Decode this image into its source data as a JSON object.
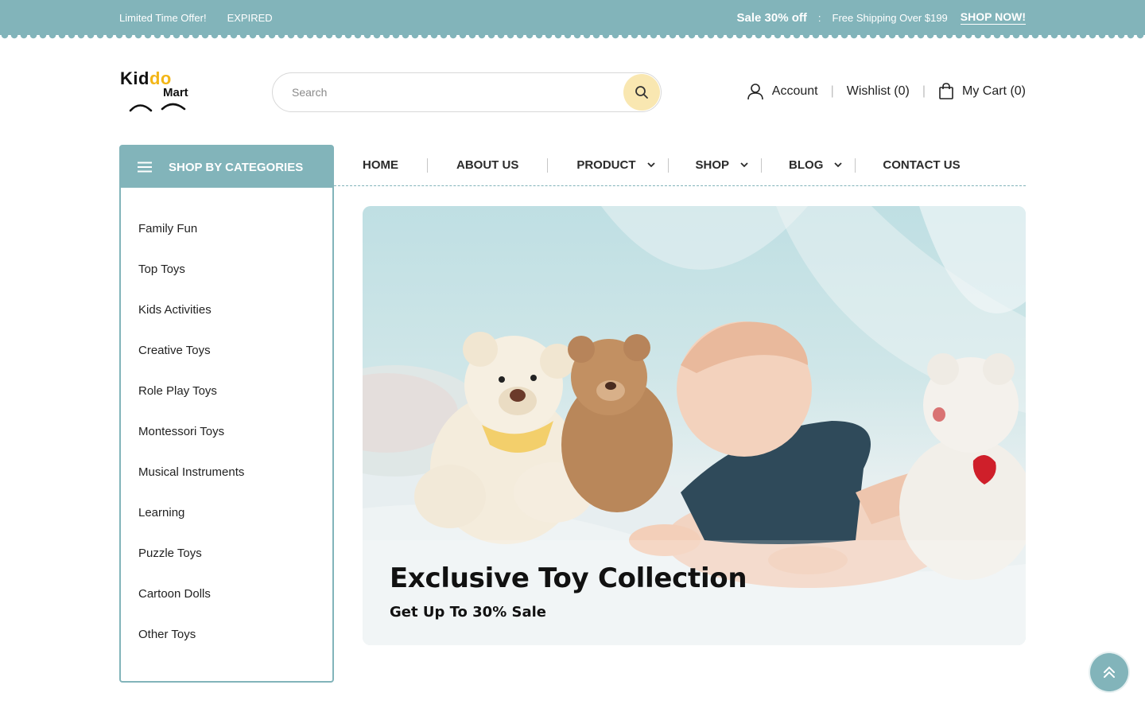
{
  "topbar": {
    "offer_label": "Limited Time Offer!",
    "offer_status": "EXPIRED",
    "sale": "Sale 30% off",
    "separator": ":",
    "shipping": "Free Shipping Over $199",
    "cta": "SHOP NOW!"
  },
  "logo": {
    "part1": "Kid",
    "part2": "do",
    "part3": "Mart"
  },
  "search": {
    "placeholder": "Search",
    "icon": "search-icon"
  },
  "header": {
    "account": "Account",
    "wishlist": "Wishlist (0)",
    "cart": "My Cart (0)"
  },
  "categories": {
    "title": "SHOP BY CATEGORIES",
    "items": [
      "Family Fun",
      "Top Toys",
      "Kids Activities",
      "Creative Toys",
      "Role Play Toys",
      "Montessori Toys",
      "Musical Instruments",
      "Learning",
      "Puzzle Toys",
      "Cartoon Dolls",
      "Other Toys"
    ]
  },
  "nav": {
    "items": [
      {
        "label": "HOME",
        "dropdown": false
      },
      {
        "label": "ABOUT US",
        "dropdown": false
      },
      {
        "label": "PRODUCT",
        "dropdown": true
      },
      {
        "label": "SHOP",
        "dropdown": true
      },
      {
        "label": "BLOG",
        "dropdown": true
      },
      {
        "label": "CONTACT US",
        "dropdown": false
      }
    ]
  },
  "banner": {
    "title": "Exclusive Toy Collection",
    "subtitle": "Get Up To 30% Sale"
  },
  "colors": {
    "accent": "#82b4ba",
    "brand_yellow": "#f3b617",
    "search_button": "#f9e7b1"
  }
}
